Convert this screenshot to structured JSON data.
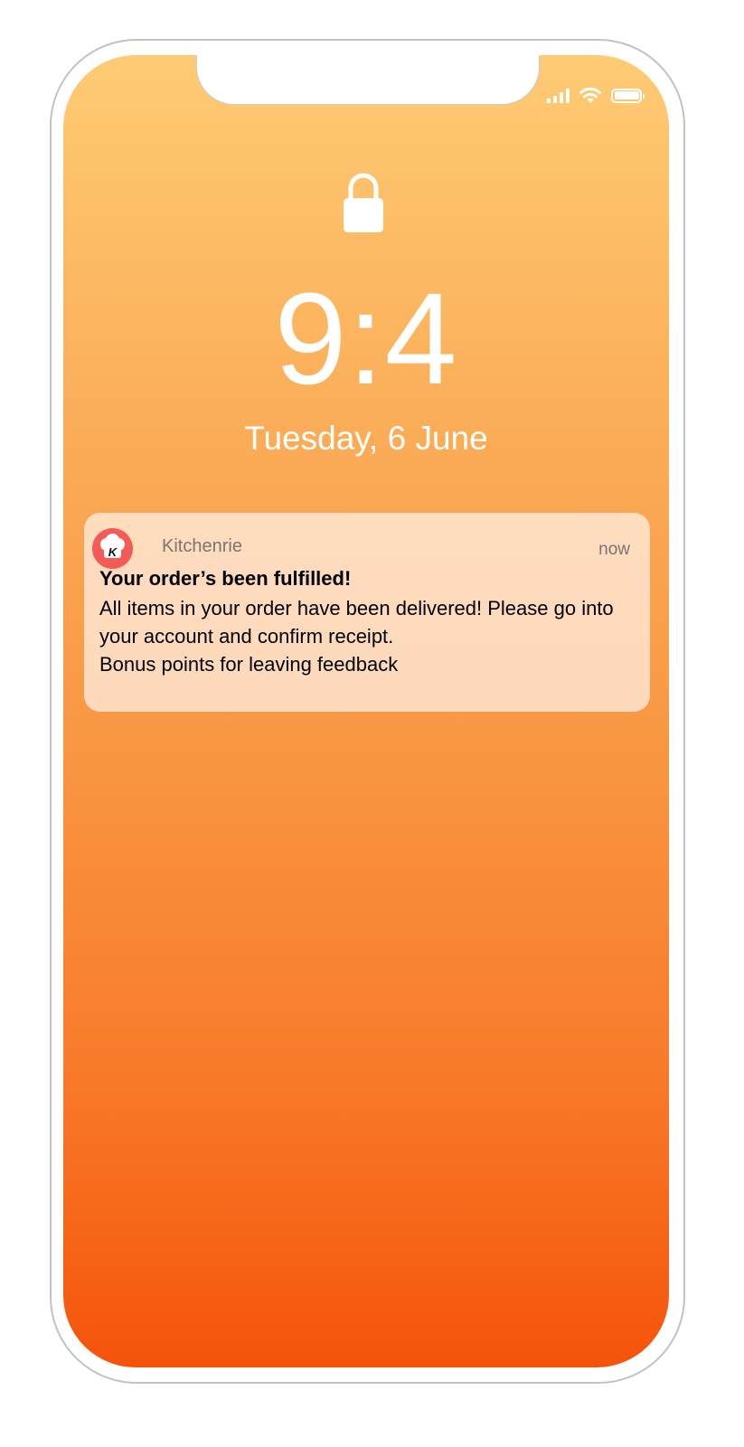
{
  "lock_screen": {
    "time": "9:4",
    "date": "Tuesday, 6 June"
  },
  "status_bar": {
    "icons": [
      "cellular-signal-icon",
      "wifi-icon",
      "battery-icon"
    ]
  },
  "notification": {
    "app_name": "Kitchenrie",
    "app_icon_letter": "K",
    "timestamp": "now",
    "title": "Your order’s been fulfilled!",
    "body": "All items in your order have been delivered! Please go into your account and confirm receipt.",
    "footer": "Bonus points for leaving feedback"
  },
  "colors": {
    "gradient_top": "#fecb74",
    "gradient_bottom": "#f5530a",
    "app_icon": "#f45b57"
  }
}
